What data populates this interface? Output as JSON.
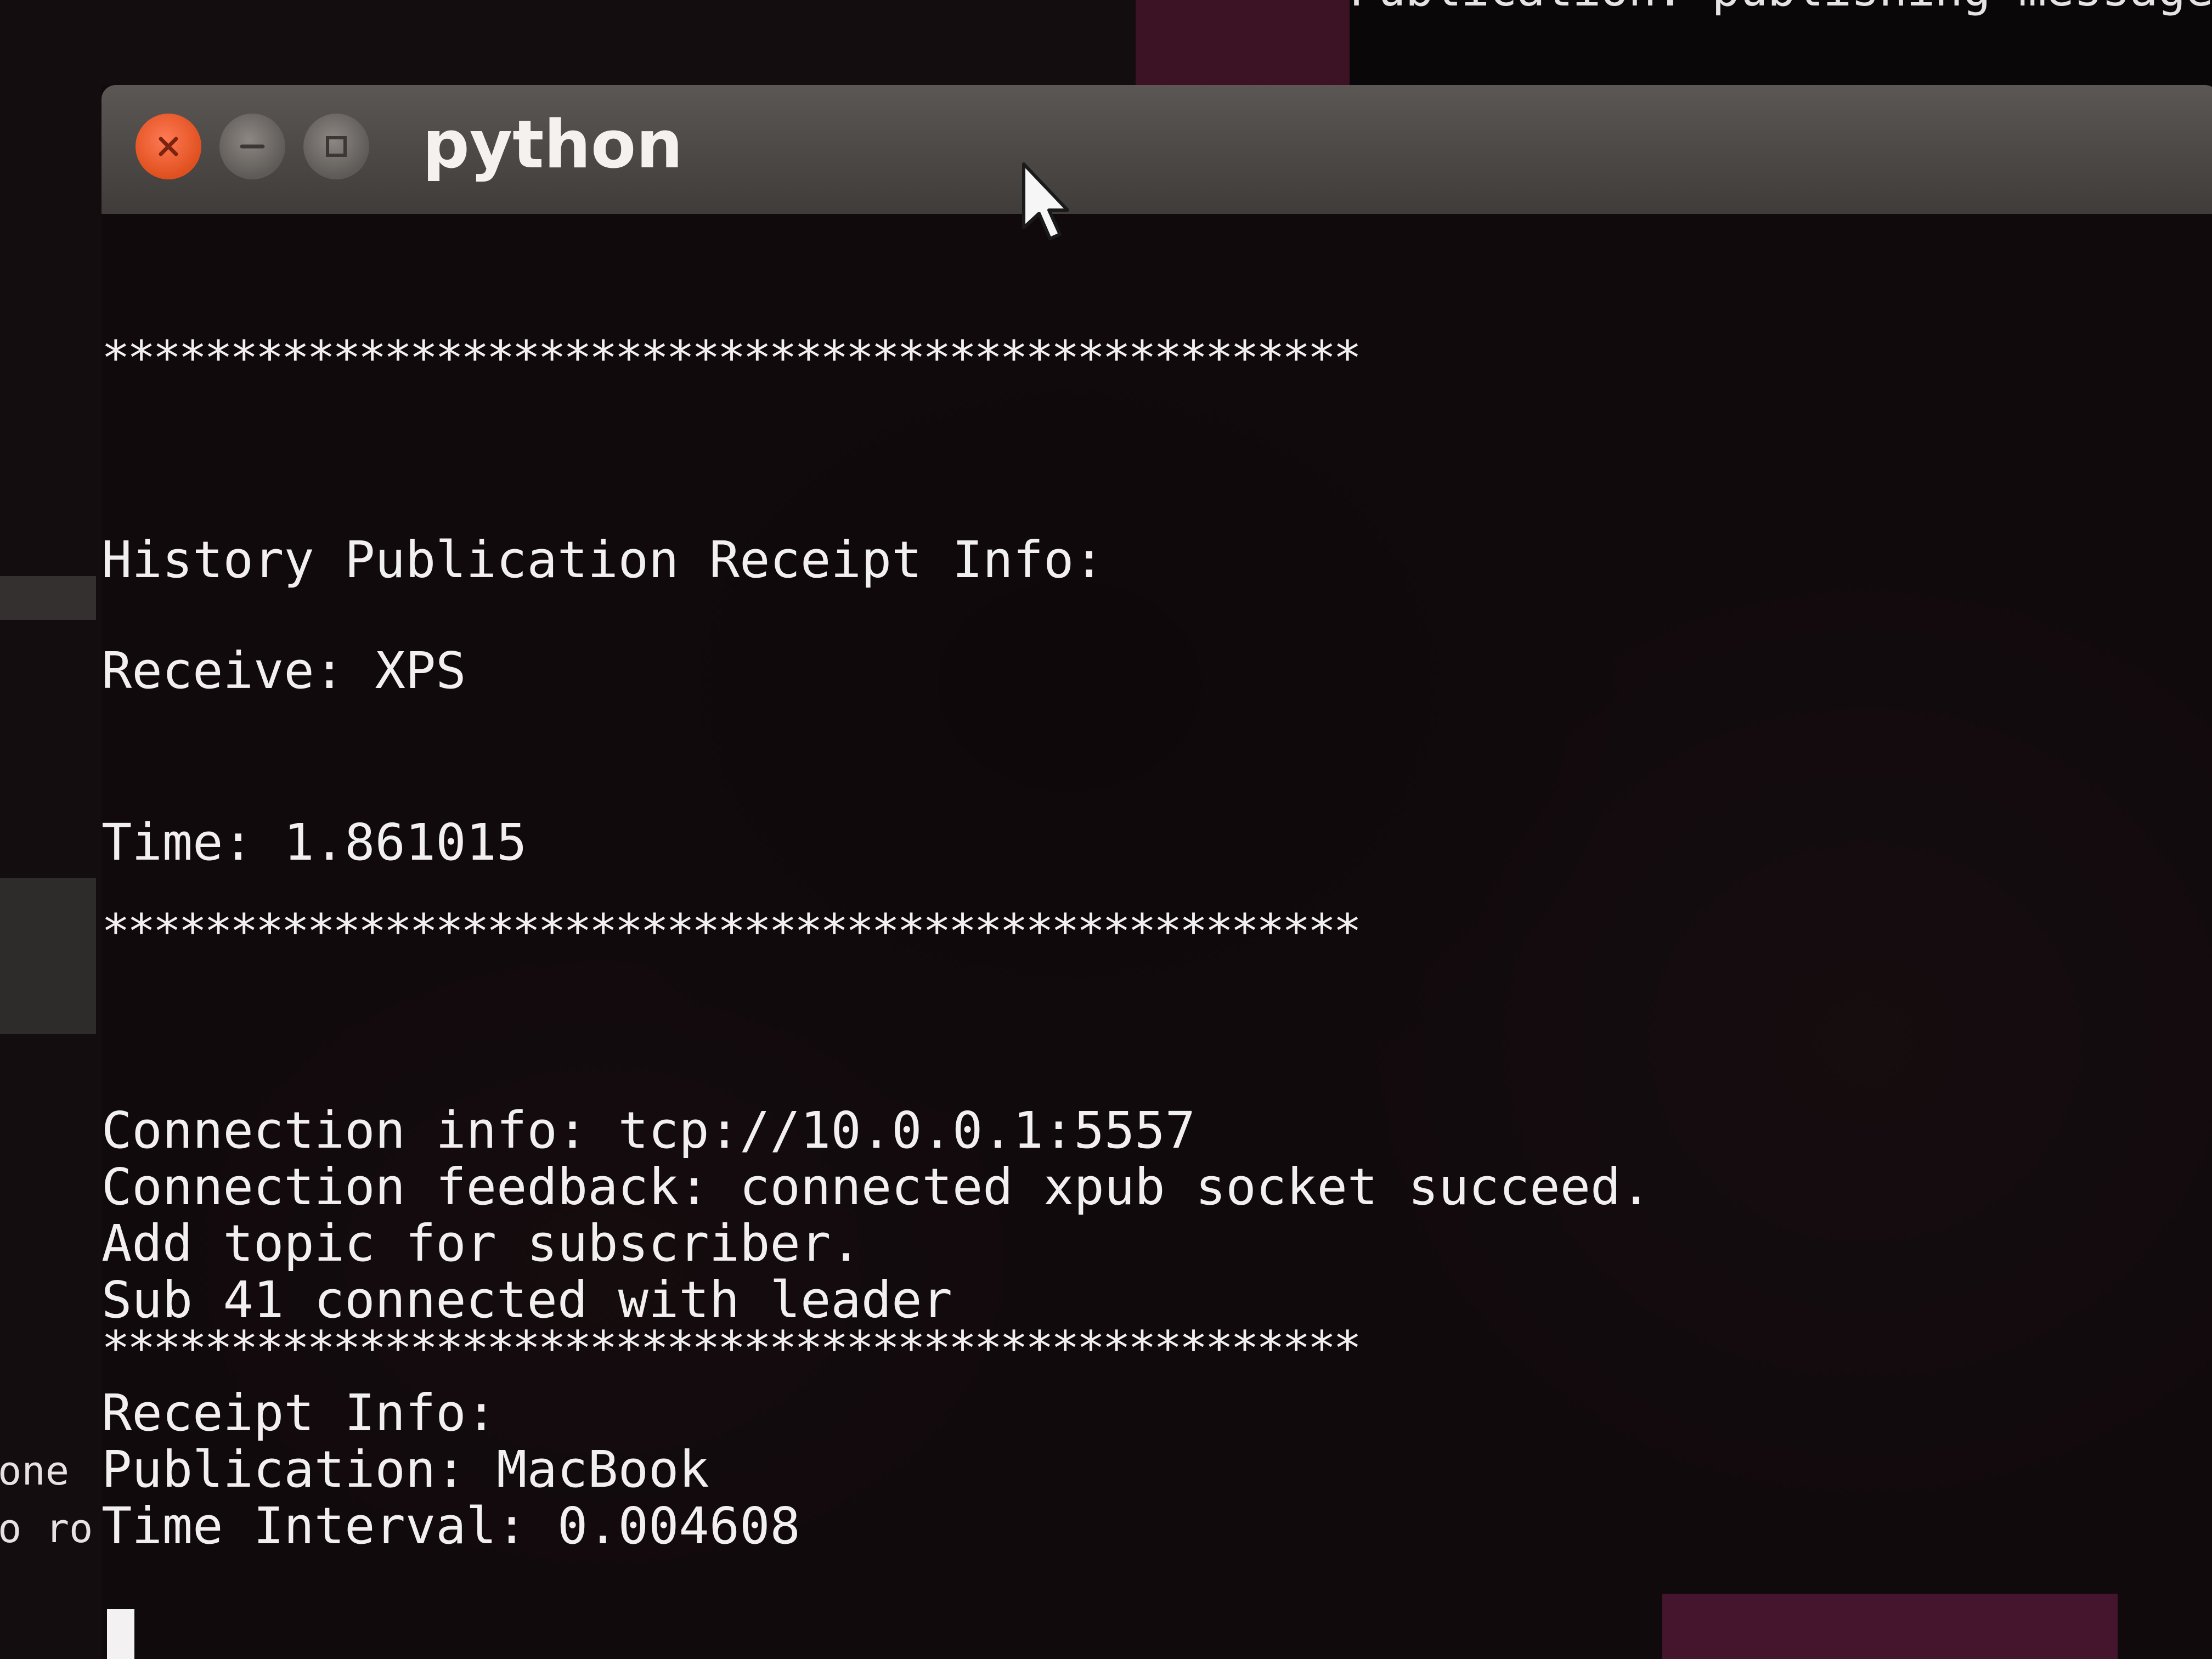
{
  "background": {
    "top_window_text": "Publication: publishing message p",
    "left_text_lines": [
      "one",
      "o ro"
    ]
  },
  "window": {
    "title": "python"
  },
  "terminal": {
    "separator_1": "*************************************************",
    "history_header": "History Publication Receipt Info:",
    "receive_line": "Receive: XPS",
    "time_line": "Time: 1.861015",
    "separator_2": "*************************************************",
    "connection_info": "Connection info: tcp://10.0.0.1:5557",
    "connection_feedback": "Connection feedback: connected xpub socket succeed.",
    "add_topic": "Add topic for subscriber.",
    "sub_connected": "Sub 41 connected with leader",
    "separator_3": "*************************************************",
    "receipt_header": "Receipt Info:",
    "publication_line": "Publication: MacBook",
    "time_interval_line": "Time Interval: 0.004608"
  },
  "colors": {
    "close_button": "#e0501f",
    "terminal_text": "#f2eff0",
    "accent_magenta": "#c9357e"
  },
  "icons": {
    "close": "close-icon",
    "minimize": "minimize-icon",
    "maximize": "maximize-icon",
    "pointer": "mouse-pointer-icon"
  }
}
